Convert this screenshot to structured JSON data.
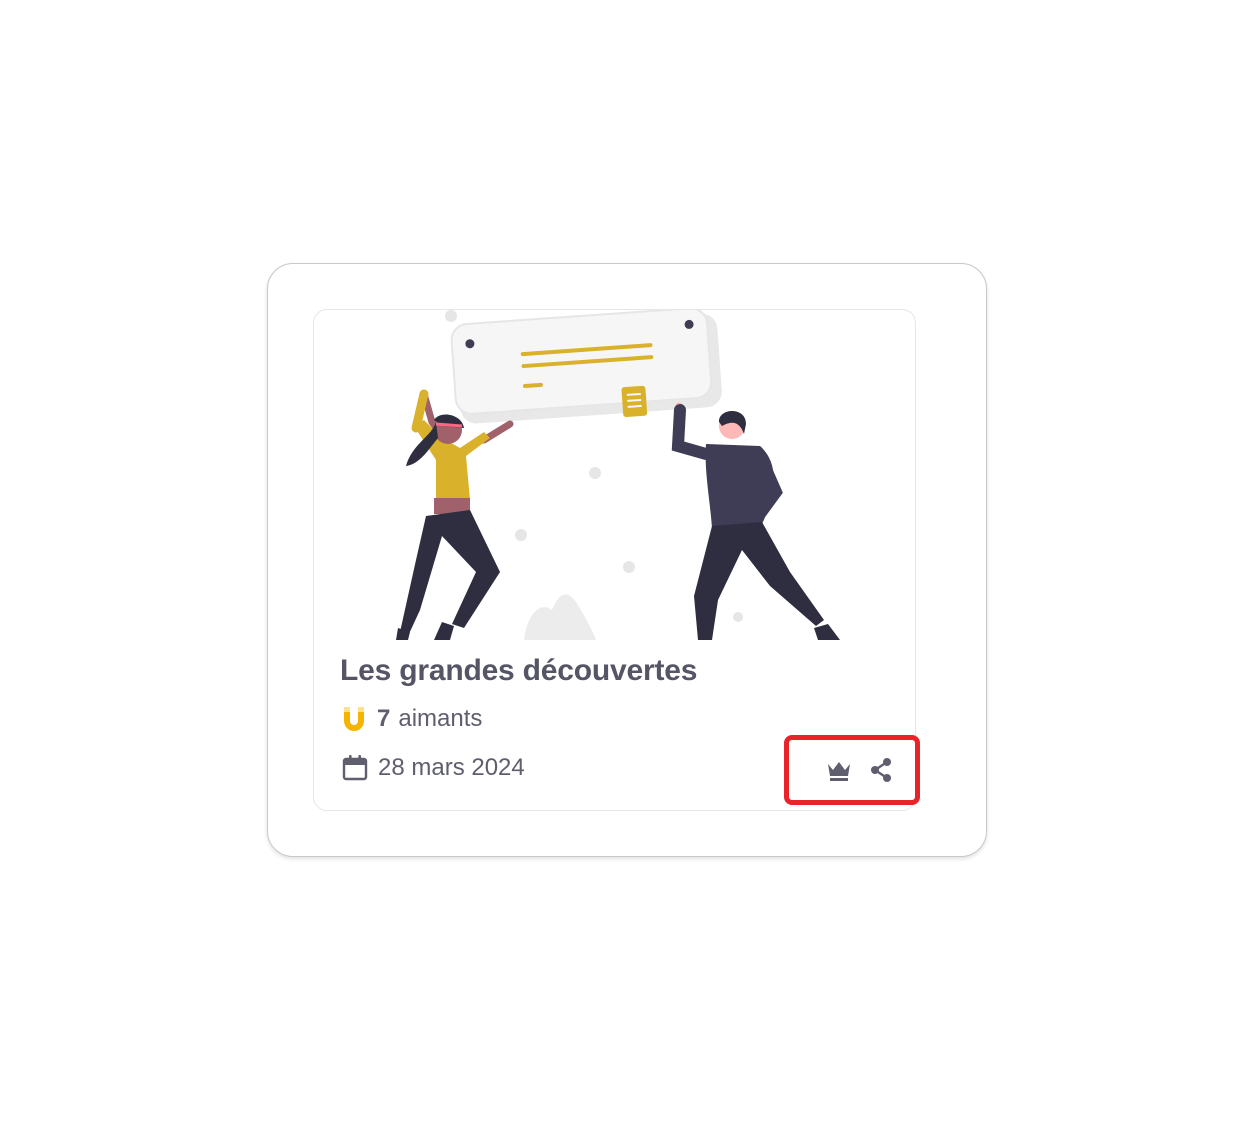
{
  "card": {
    "title": "Les grandes découvertes",
    "magnets": {
      "count": "7",
      "label": "aimants",
      "icon": "magnet-icon",
      "color": "#f5b400"
    },
    "date": {
      "value": "28 mars 2024",
      "icon": "calendar-icon"
    },
    "actions": [
      {
        "name": "crown-button",
        "icon": "crown-icon"
      },
      {
        "name": "share-button",
        "icon": "share-icon"
      }
    ],
    "illustration": {
      "name": "celebration-illustration",
      "accent_color": "#d9b12b",
      "dark_color": "#3f3d56"
    }
  },
  "colors": {
    "text": "#5e5e6e",
    "title": "#555566",
    "highlight_border": "#e8232a"
  }
}
